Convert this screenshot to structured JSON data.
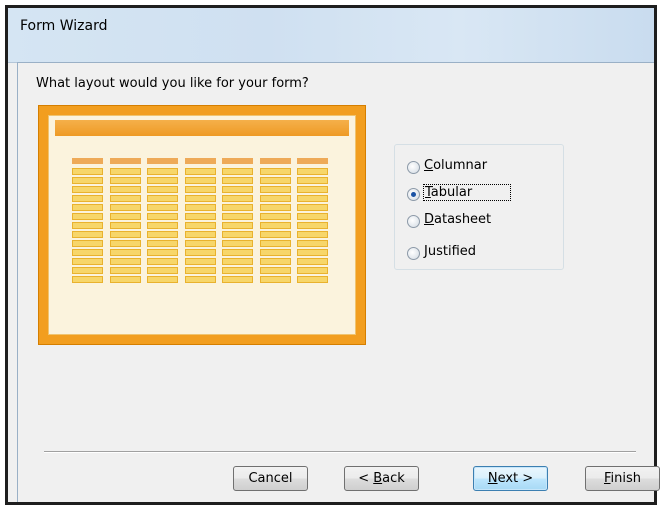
{
  "window": {
    "title": "Form Wizard"
  },
  "prompt": "What layout would you like for your form?",
  "layout_options": [
    {
      "label": "Columnar",
      "mnemonic": "C",
      "rest": "olumnar",
      "selected": false
    },
    {
      "label": "Tabular",
      "mnemonic": "T",
      "rest": "abular",
      "selected": true
    },
    {
      "label": "Datasheet",
      "mnemonic": "D",
      "rest": "atasheet",
      "selected": false
    },
    {
      "label": "Justified",
      "mnemonic": "J",
      "rest": "ustified",
      "selected": false
    }
  ],
  "buttons": {
    "cancel": "Cancel",
    "back_prefix": "< ",
    "back_mnemonic": "B",
    "back_rest": "ack",
    "next_mnemonic": "N",
    "next_rest": "ext >",
    "finish_mnemonic": "F",
    "finish_rest": "inish"
  },
  "colors": {
    "preview_accent": "#f29e1f",
    "preview_cell": "#f7d66a",
    "selected_radio": "#1a52a4"
  }
}
